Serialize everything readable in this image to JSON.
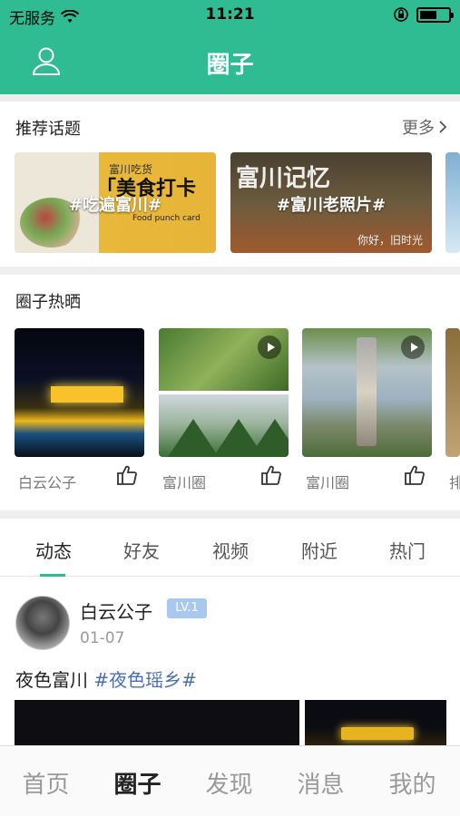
{
  "status_bar": {
    "carrier": "无服务",
    "time": "11:21"
  },
  "nav": {
    "title": "圈子"
  },
  "topics": {
    "title": "推荐话题",
    "more_label": "更多",
    "cards": [
      {
        "tag": "#吃遍富川#",
        "brand_small": "富川吃货",
        "brand_big": "「美食打卡",
        "caption": "Food punch card"
      },
      {
        "tag": "#富川老照片#",
        "big_text": "富川记忆",
        "caption": "你好，旧时光"
      }
    ]
  },
  "hot": {
    "title": "圈子热晒",
    "cards": [
      {
        "label": "白云公子",
        "video": false
      },
      {
        "label": "富川圈",
        "video": true
      },
      {
        "label": "富川圈",
        "video": true
      },
      {
        "label": "排",
        "video": false
      }
    ]
  },
  "feed": {
    "tabs": [
      "动态",
      "好友",
      "视频",
      "附近",
      "热门"
    ],
    "active_tab": "动态",
    "post": {
      "user": "白云公子",
      "level": "LV.1",
      "date": "01-07",
      "text": "夜色富川",
      "tag": "#夜色瑶乡#"
    }
  },
  "tabbar": {
    "items": [
      "首页",
      "圈子",
      "发现",
      "消息",
      "我的"
    ],
    "active": "圈子"
  },
  "colors": {
    "brand": "#2fbc92",
    "level_badge": "#a9c8f0",
    "topic_tag": "#4a6fb0"
  },
  "icons": [
    "wifi-icon",
    "lock-rotation-icon",
    "battery-icon",
    "user-icon",
    "chevron-right-icon",
    "play-icon",
    "thumbs-up-icon"
  ]
}
